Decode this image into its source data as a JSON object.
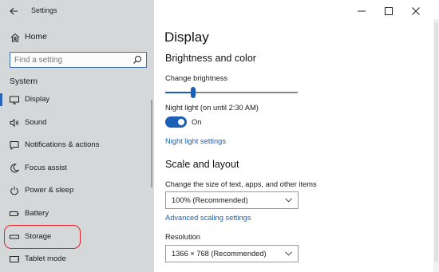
{
  "window": {
    "title": "Settings"
  },
  "sidebar": {
    "home_label": "Home",
    "search_placeholder": "Find a setting",
    "section": "System",
    "items": [
      {
        "label": "Display",
        "icon": "monitor-icon",
        "selected": true
      },
      {
        "label": "Sound",
        "icon": "speaker-icon"
      },
      {
        "label": "Notifications & actions",
        "icon": "notification-icon"
      },
      {
        "label": "Focus assist",
        "icon": "moon-icon"
      },
      {
        "label": "Power & sleep",
        "icon": "power-icon"
      },
      {
        "label": "Battery",
        "icon": "battery-icon"
      },
      {
        "label": "Storage",
        "icon": "storage-icon",
        "annotated": true
      },
      {
        "label": "Tablet mode",
        "icon": "tablet-icon"
      }
    ]
  },
  "main": {
    "title": "Display",
    "brightness_section": "Brightness and color",
    "change_brightness": "Change brightness",
    "brightness_level": 0.21,
    "night_light_label": "Night light (on until 2:30 AM)",
    "night_light_state": "On",
    "night_light_settings": "Night light settings",
    "scale_section": "Scale and layout",
    "scale_label": "Change the size of text, apps, and other items",
    "scale_value": "100% (Recommended)",
    "advanced_scaling": "Advanced scaling settings",
    "resolution_label": "Resolution",
    "resolution_value": "1366 × 768 (Recommended)"
  },
  "colors": {
    "accent": "#1b5fb6",
    "sidebar_bg": "#d4d8d9",
    "annotation": "#e3232a"
  }
}
